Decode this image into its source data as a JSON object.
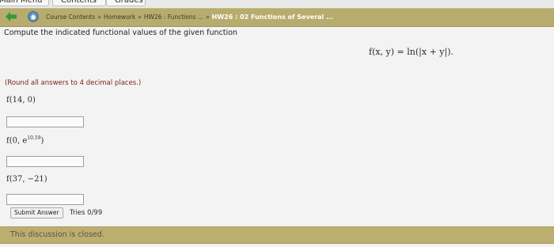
{
  "tabs": [
    "Main Menu",
    "Contents",
    "Grades"
  ],
  "breadcrumb": {
    "items": [
      "Course Contents",
      "Homework",
      "HW26 : Functions ..."
    ],
    "current": "HW26 : 02 Functions of Several ...",
    "separator": "»"
  },
  "question": {
    "prompt": "Compute the indicated functional values of the given function",
    "formula": "f(x, y) = ln(|x + y|).",
    "round_note": "(Round all answers to 4 decimal places.)",
    "parts": [
      {
        "label_base": "f(14, 0)",
        "label_sup": "",
        "label_tail": "",
        "answer": ""
      },
      {
        "label_base": "f(0, e",
        "label_sup": "10.59",
        "label_tail": ")",
        "answer": ""
      },
      {
        "label_base": "f(37, −21)",
        "label_sup": "",
        "label_tail": "",
        "answer": ""
      }
    ]
  },
  "submit": {
    "label": "Submit Answer",
    "tries": "Tries 0/99"
  },
  "footer": {
    "message": "This discussion is closed."
  },
  "colors": {
    "header_bar": "#b7ac6e",
    "footer_bar": "#bcae6f",
    "note_text": "#7a2418",
    "back_arrow": "#2f9a3a"
  }
}
